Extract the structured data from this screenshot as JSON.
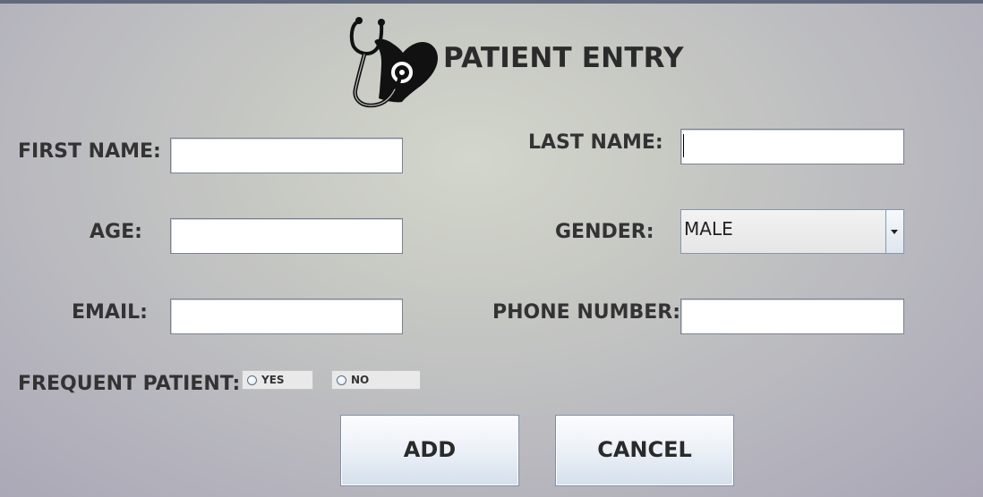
{
  "window": {
    "title": "PATIENT ENTRY",
    "logo_icon": "heart-stethoscope-icon"
  },
  "form": {
    "first_name": {
      "label": "FIRST NAME:",
      "value": ""
    },
    "last_name": {
      "label": "LAST NAME:",
      "value": ""
    },
    "age": {
      "label": "AGE:",
      "value": ""
    },
    "gender": {
      "label": "GENDER:",
      "selected": "MALE"
    },
    "email": {
      "label": "EMAIL:",
      "value": ""
    },
    "phone": {
      "label": "PHONE NUMBER:",
      "value": ""
    },
    "frequent_patient": {
      "label": "FREQUENT PATIENT:",
      "options": [
        "YES",
        "NO"
      ],
      "selected": null
    }
  },
  "buttons": {
    "add": "ADD",
    "cancel": "CANCEL"
  },
  "colors": {
    "title": "#2b2b2b",
    "label": "#333333",
    "field_border": "#7a8290",
    "button_border": "#7f8fa8"
  }
}
